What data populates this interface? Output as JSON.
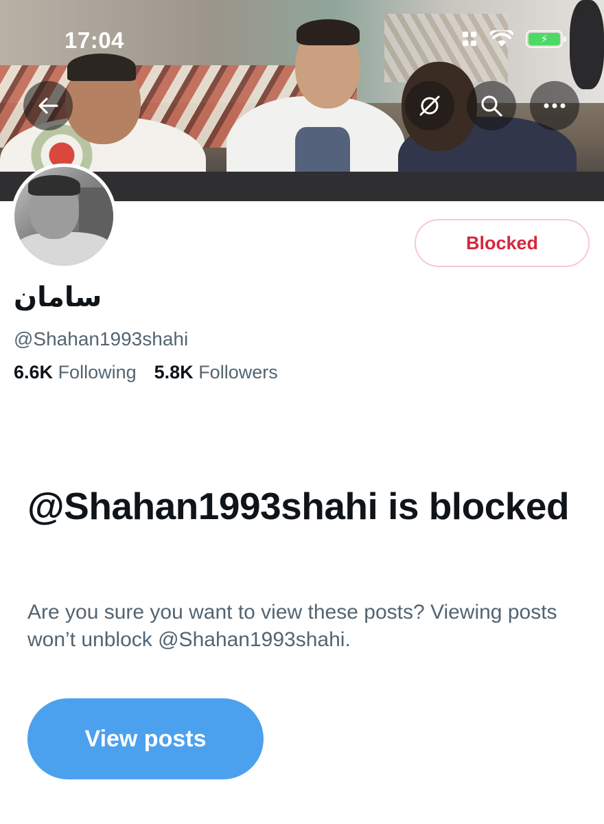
{
  "status_bar": {
    "time": "17:04"
  },
  "profile": {
    "display_name": "سامان",
    "handle": "@Shahan1993shahi",
    "following_count": "6.6K",
    "following_label": "Following",
    "followers_count": "5.8K",
    "followers_label": "Followers"
  },
  "actions": {
    "blocked_label": "Blocked"
  },
  "blocked_notice": {
    "title": "@Shahan1993shahi is blocked",
    "description": "Are you sure you want to view these posts? Viewing posts won’t unblock @Shahan1993shahi.",
    "view_posts_label": "View posts"
  },
  "icons": {
    "back": "arrow-left-icon",
    "grok": "grok-icon",
    "search": "search-icon",
    "more": "more-icon",
    "wifi": "wifi-icon",
    "battery": "battery-charging-icon",
    "signal": "cellular-icon"
  },
  "colors": {
    "blocked_text": "#d7263d",
    "blocked_border": "#f7c9cf",
    "view_posts_bg": "#4ca1ef",
    "secondary_text": "#536471",
    "primary_text": "#0f1419"
  }
}
